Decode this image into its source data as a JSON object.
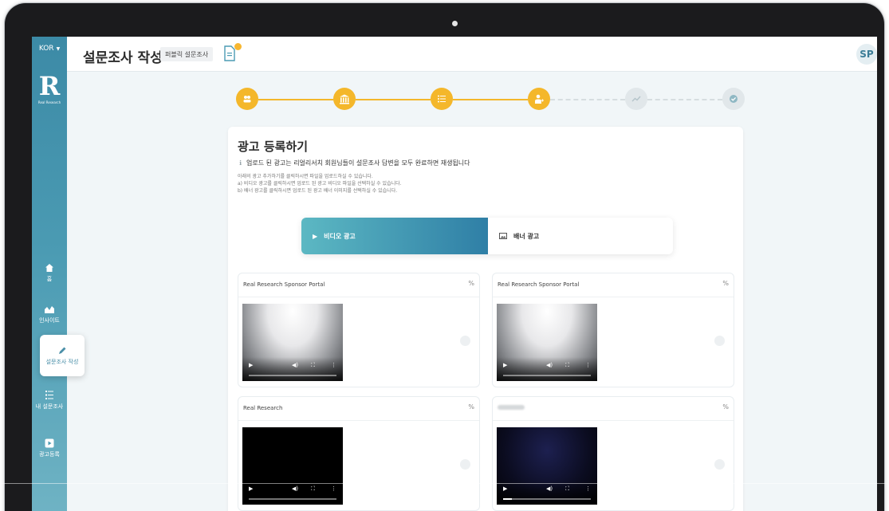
{
  "sidebar": {
    "lang": "KOR",
    "logo_caption": "Real Research",
    "items": [
      {
        "label": "홈",
        "icon": "home-icon"
      },
      {
        "label": "인사이트",
        "icon": "chart-icon"
      },
      {
        "label": "설문조사 작성",
        "icon": "pencil-icon",
        "active": true
      },
      {
        "label": "내 설문조사",
        "icon": "list-icon"
      },
      {
        "label": "광고등록",
        "icon": "play-icon"
      }
    ]
  },
  "header": {
    "title": "설문조사 작성",
    "badge": "퍼블릭 설문조사",
    "avatar": "SP"
  },
  "stepper": {
    "total": 6,
    "completed": 4,
    "accent": "#f4b72b"
  },
  "card": {
    "title": "광고 등록하기",
    "notice": "업로드 된 광고는 리얼리서치 회원님들이 설문조사 답변을 모두 완료하면 재생됩니다",
    "help": [
      "아래의 광고 추가하기를 클릭하시면 파일을 업로드하실 수 있습니다.",
      "a) 비디오 광고를 클릭하시면 업로드 된 광고 비디오 파일을 선택하실 수 있습니다.",
      "b) 배너 광고를 클릭하시면 업로드 된 광고 배너 이미지를 선택하실 수 있습니다."
    ],
    "toggle": {
      "video_label": "비디오 광고",
      "banner_label": "배너 광고"
    }
  },
  "ads": [
    {
      "title": "Real Research Sponsor Portal",
      "progress": 0.0
    },
    {
      "title": "Real Research Sponsor Portal",
      "progress": 0.0
    },
    {
      "title": "Real Research",
      "progress": 0.0
    },
    {
      "title": "",
      "progress": 0.1
    }
  ]
}
